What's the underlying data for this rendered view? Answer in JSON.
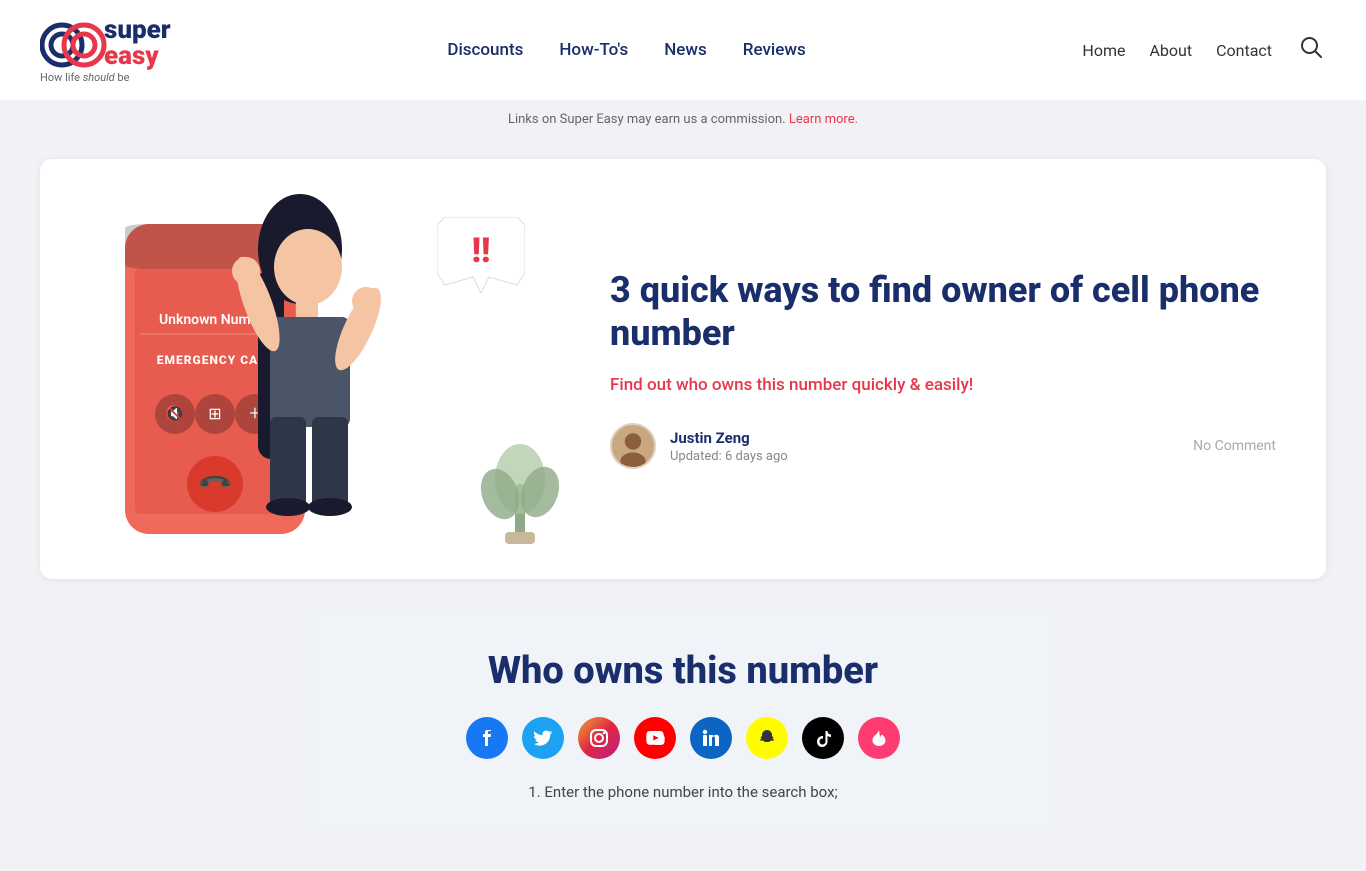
{
  "header": {
    "logo": {
      "super": "super",
      "easy": "easy",
      "tagline_normal": "How life ",
      "tagline_italic": "should",
      "tagline_end": " be"
    },
    "main_nav": [
      {
        "label": "Discounts",
        "href": "#"
      },
      {
        "label": "How-To's",
        "href": "#"
      },
      {
        "label": "News",
        "href": "#"
      },
      {
        "label": "Reviews",
        "href": "#"
      }
    ],
    "right_nav": [
      {
        "label": "Home",
        "href": "#"
      },
      {
        "label": "About",
        "href": "#"
      },
      {
        "label": "Contact",
        "href": "#"
      }
    ],
    "search_aria": "Search"
  },
  "commission_bar": {
    "text": "Links on Super Easy may earn us a commission. ",
    "link_text": "Learn more."
  },
  "article": {
    "title": "3 quick ways to find owner of cell phone number",
    "subtitle": "Find out who owns this number quickly & easily!",
    "author_name": "Justin Zeng",
    "author_updated": "Updated: 6 days ago",
    "no_comment": "No Comment",
    "phone_unknown": "Unknown Number",
    "phone_emergency": "EMERGENCY CALL"
  },
  "who_owns": {
    "title": "Who owns this number",
    "social_icons": [
      {
        "name": "facebook",
        "class": "si-facebook",
        "symbol": "f"
      },
      {
        "name": "twitter",
        "class": "si-twitter",
        "symbol": "t"
      },
      {
        "name": "instagram",
        "class": "si-instagram",
        "symbol": "📷"
      },
      {
        "name": "youtube",
        "class": "si-youtube",
        "symbol": "▶"
      },
      {
        "name": "linkedin",
        "class": "si-linkedin",
        "symbol": "in"
      },
      {
        "name": "snapchat",
        "class": "si-snapchat",
        "symbol": "👻"
      },
      {
        "name": "tiktok",
        "class": "si-tiktok",
        "symbol": "♪"
      },
      {
        "name": "tinder",
        "class": "si-tinder",
        "symbol": "🔥"
      }
    ],
    "instruction": "1. Enter the phone number into the search box;"
  }
}
